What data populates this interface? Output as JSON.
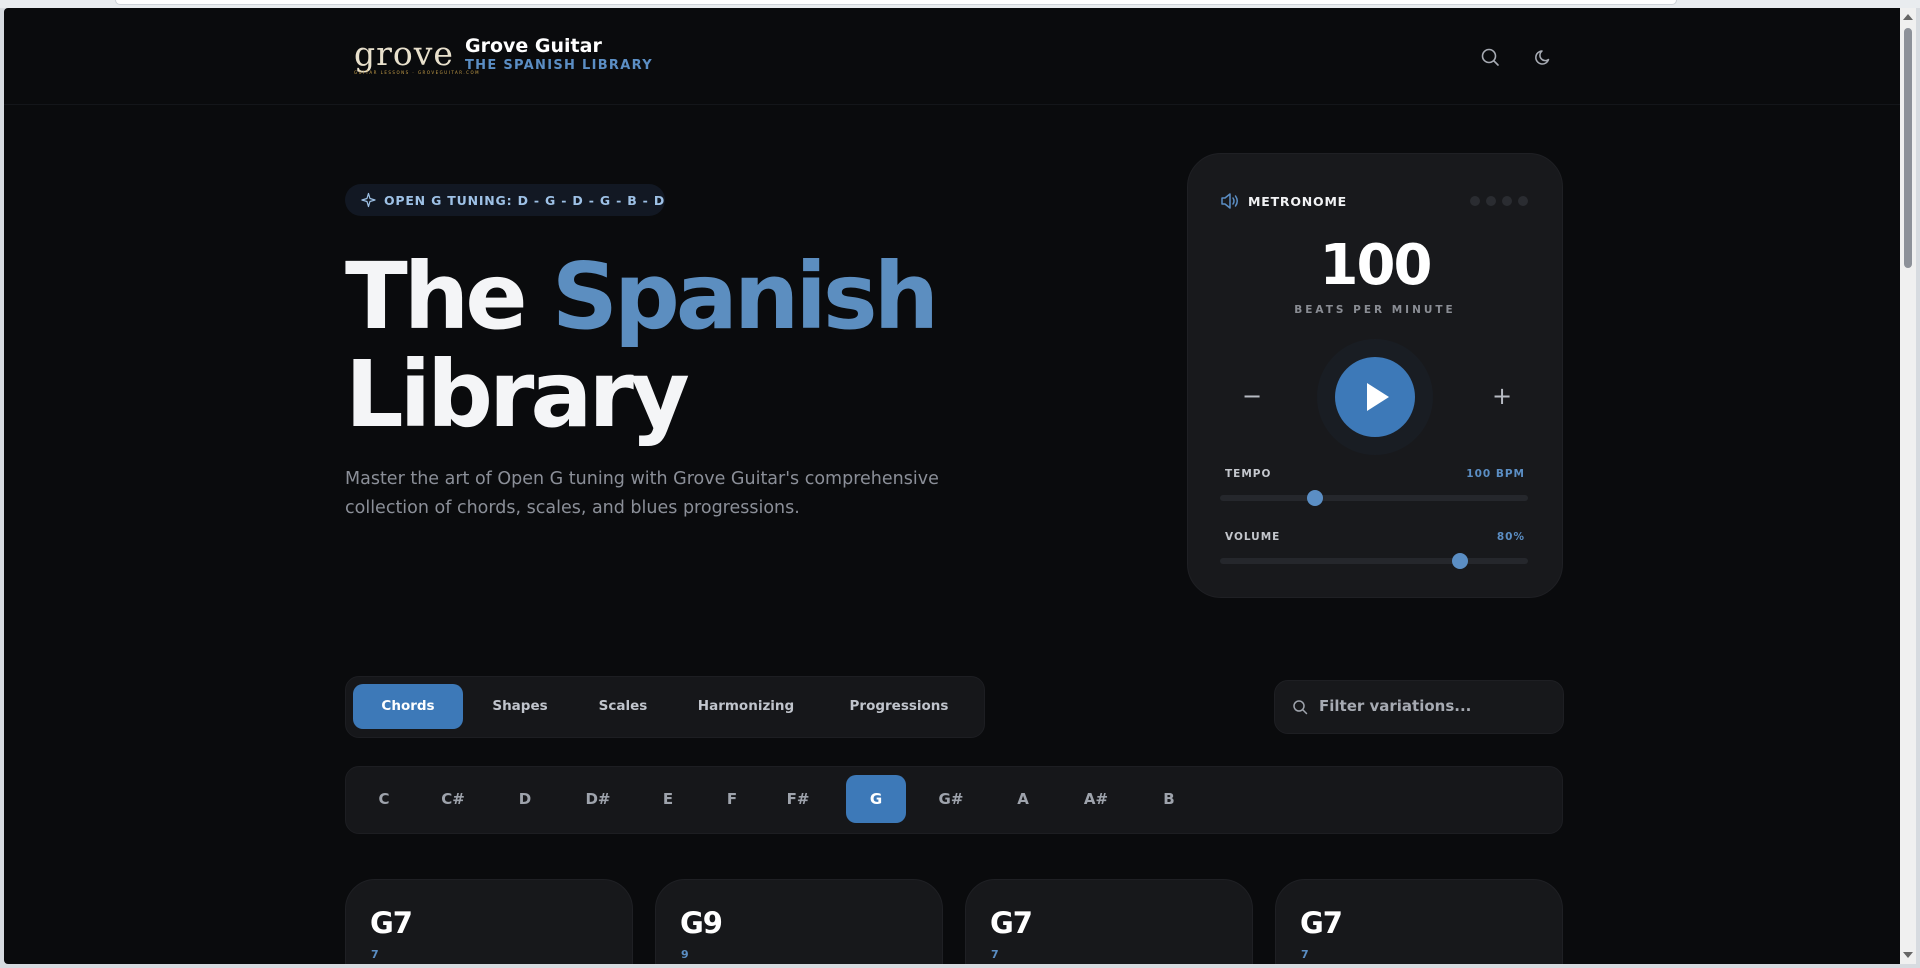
{
  "header": {
    "logo_text": "grove",
    "logo_tagline": "GUITAR LESSONS · GROVEGUITAR.COM",
    "title": "Grove Guitar",
    "subtitle": "THE SPANISH LIBRARY",
    "icons": [
      "search-icon",
      "moon-icon"
    ]
  },
  "hero": {
    "badge": "OPEN G TUNING: D - G - D - G - B - D",
    "title_part1": "The",
    "title_accent": "Spanish",
    "title_part2": "Library",
    "description": "Master the art of Open G tuning with Grove Guitar's comprehensive collection of chords, scales, and blues progressions."
  },
  "metronome": {
    "label": "METRONOME",
    "bpm": "100",
    "bpm_label": "BEATS PER MINUTE",
    "minus": "−",
    "plus": "+",
    "tempo_label": "TEMPO",
    "tempo_value": "100 BPM",
    "tempo_fraction": 0.31,
    "volume_label": "VOLUME",
    "volume_value": "80%",
    "volume_fraction": 0.78
  },
  "tabs": [
    {
      "label": "Chords",
      "active": true
    },
    {
      "label": "Shapes",
      "active": false
    },
    {
      "label": "Scales",
      "active": false
    },
    {
      "label": "Harmonizing",
      "active": false
    },
    {
      "label": "Progressions",
      "active": false
    }
  ],
  "filter": {
    "placeholder": "Filter variations..."
  },
  "keys": [
    "C",
    "C#",
    "D",
    "D#",
    "E",
    "F",
    "F#",
    "G",
    "G#",
    "A",
    "A#",
    "B"
  ],
  "active_key": "G",
  "cards": [
    {
      "name": "G7",
      "sub": "7"
    },
    {
      "name": "G9",
      "sub": "9"
    },
    {
      "name": "G7",
      "sub": "7"
    },
    {
      "name": "G7",
      "sub": "7"
    }
  ],
  "colors": {
    "accent": "#3d79b8",
    "accent_text": "#5b8ec4",
    "background": "#0a0b0d"
  }
}
